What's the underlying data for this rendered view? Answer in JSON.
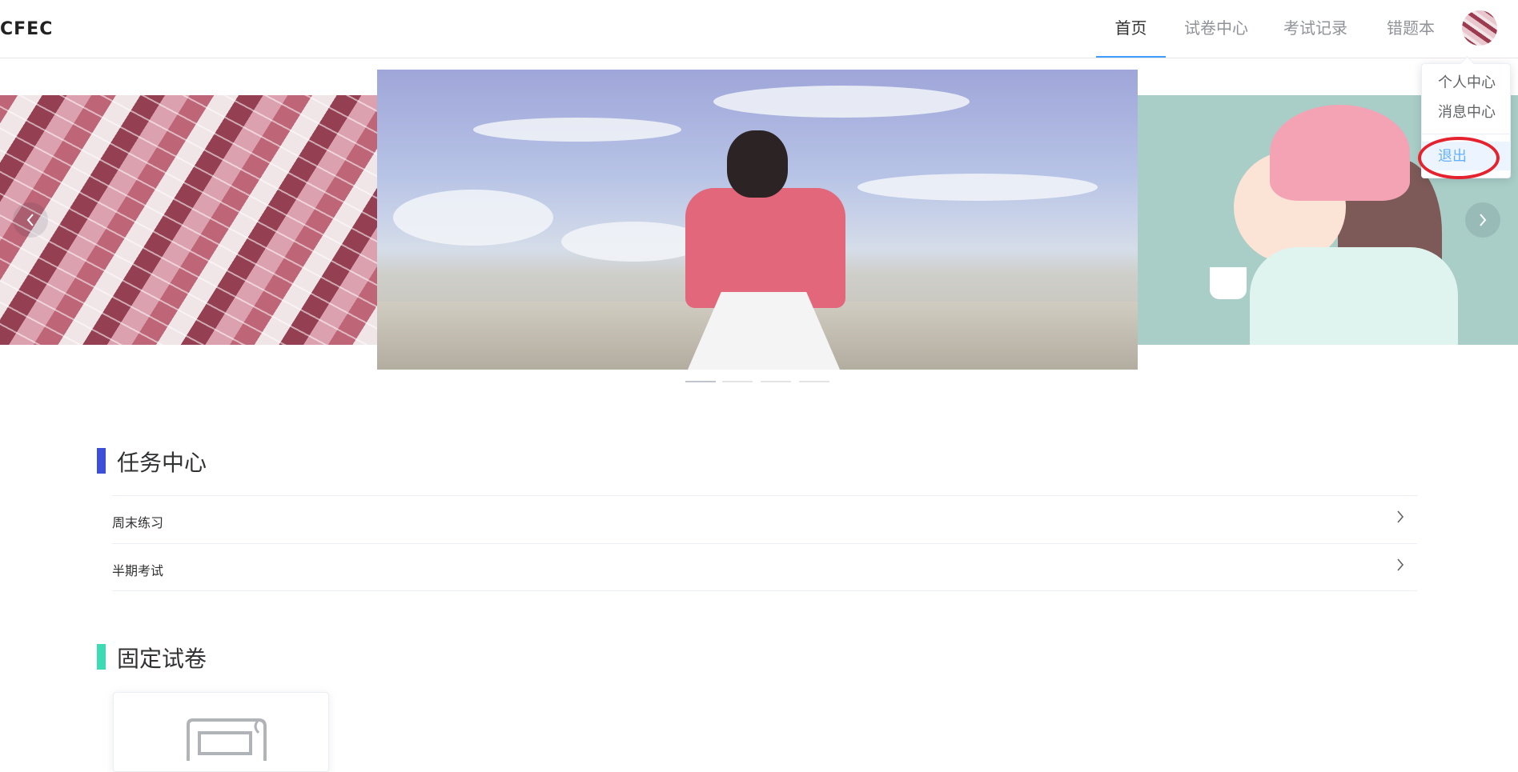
{
  "header": {
    "logo_text": "CFEC",
    "nav": [
      {
        "label": "首页",
        "active": true
      },
      {
        "label": "试卷中心",
        "active": false
      },
      {
        "label": "考试记录",
        "active": false
      },
      {
        "label": "错题本",
        "active": false
      }
    ],
    "accent_color": "#409eff"
  },
  "user_menu": {
    "items": [
      {
        "label": "个人中心"
      },
      {
        "label": "消息中心"
      },
      {
        "label": "退出",
        "highlighted": true
      }
    ]
  },
  "carousel": {
    "slide_count": 4,
    "active_index": 0,
    "prev_icon": "chevron-left-icon",
    "next_icon": "chevron-right-icon"
  },
  "task_center": {
    "title": "任务中心",
    "bar_color": "#3b4fd9",
    "items": [
      {
        "label": "周末练习"
      },
      {
        "label": "半期考试"
      }
    ]
  },
  "fixed_papers": {
    "title": "固定试卷",
    "bar_color": "#3ddbb3",
    "icon": "document-icon"
  }
}
